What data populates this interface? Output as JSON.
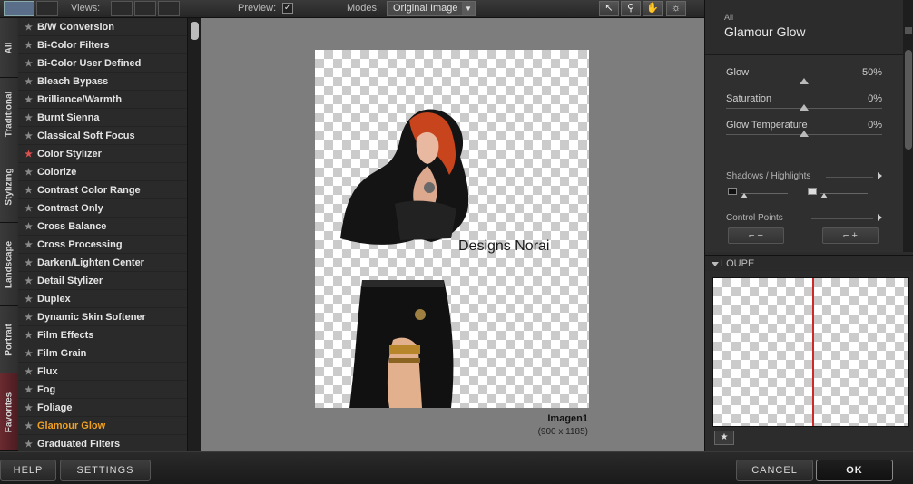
{
  "toolbar": {
    "views_label": "Views:",
    "preview_label": "Preview:",
    "preview_checked": true,
    "modes_label": "Modes:",
    "modes_value": "Original Image",
    "tools": [
      "pointer-icon",
      "zoom-icon",
      "hand-icon",
      "light-icon"
    ]
  },
  "category_tabs": [
    "All",
    "Traditional",
    "Stylizing",
    "Landscape",
    "Portrait",
    "Favorites"
  ],
  "filters": [
    {
      "label": "B/W Conversion",
      "starred": false,
      "selected": false
    },
    {
      "label": "Bi-Color Filters",
      "starred": false,
      "selected": false
    },
    {
      "label": "Bi-Color User Defined",
      "starred": false,
      "selected": false
    },
    {
      "label": "Bleach Bypass",
      "starred": false,
      "selected": false
    },
    {
      "label": "Brilliance/Warmth",
      "starred": false,
      "selected": false
    },
    {
      "label": "Burnt Sienna",
      "starred": false,
      "selected": false
    },
    {
      "label": "Classical Soft Focus",
      "starred": false,
      "selected": false
    },
    {
      "label": "Color Stylizer",
      "starred": true,
      "selected": false
    },
    {
      "label": "Colorize",
      "starred": false,
      "selected": false
    },
    {
      "label": "Contrast Color Range",
      "starred": false,
      "selected": false
    },
    {
      "label": "Contrast Only",
      "starred": false,
      "selected": false
    },
    {
      "label": "Cross Balance",
      "starred": false,
      "selected": false
    },
    {
      "label": "Cross Processing",
      "starred": false,
      "selected": false
    },
    {
      "label": "Darken/Lighten Center",
      "starred": false,
      "selected": false
    },
    {
      "label": "Detail Stylizer",
      "starred": false,
      "selected": false
    },
    {
      "label": "Duplex",
      "starred": false,
      "selected": false
    },
    {
      "label": "Dynamic Skin Softener",
      "starred": false,
      "selected": false
    },
    {
      "label": "Film Effects",
      "starred": false,
      "selected": false
    },
    {
      "label": "Film Grain",
      "starred": false,
      "selected": false
    },
    {
      "label": "Flux",
      "starred": false,
      "selected": false
    },
    {
      "label": "Fog",
      "starred": false,
      "selected": false
    },
    {
      "label": "Foliage",
      "starred": false,
      "selected": false
    },
    {
      "label": "Glamour Glow",
      "starred": false,
      "selected": true
    },
    {
      "label": "Graduated Filters",
      "starred": false,
      "selected": false
    }
  ],
  "preview": {
    "watermark": "Designs Norai",
    "image_name": "Imagen1",
    "image_size": "(900 x 1185)"
  },
  "panel": {
    "breadcrumb": "All",
    "title": "Glamour Glow",
    "sliders": [
      {
        "label": "Glow",
        "value": "50%",
        "level": 0.5
      },
      {
        "label": "Saturation",
        "value": "0%",
        "level": 0.5
      },
      {
        "label": "Glow Temperature",
        "value": "0%",
        "level": 0.5
      }
    ],
    "shadows_label": "Shadows / Highlights",
    "control_points_label": "Control Points",
    "loupe_label": "LOUPE"
  },
  "bottom": {
    "help": "HELP",
    "settings": "SETTINGS",
    "cancel": "CANCEL",
    "ok": "OK"
  },
  "colors": {
    "selected_filter": "#f0a020",
    "star_favorite": "#e05050",
    "loupe_line": "#cc2a2a"
  }
}
